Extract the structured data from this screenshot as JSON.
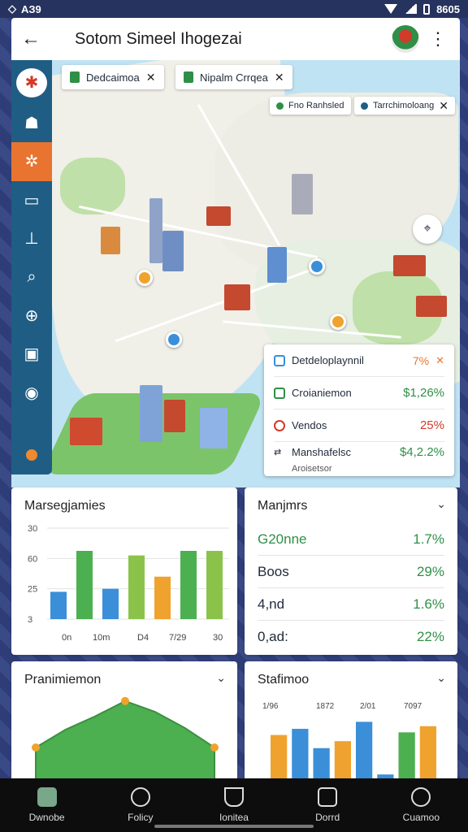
{
  "status_bar": {
    "time": "AЗ9",
    "right_text": "8605"
  },
  "app_bar": {
    "title": "Sotom Simeel Ihogezai"
  },
  "chips": [
    {
      "label": "Dedcaimoa"
    },
    {
      "label": "Nipalm Crrqea"
    },
    {
      "label": "Fno Ranhsled"
    },
    {
      "label": "Tarrchimoloang"
    }
  ],
  "legend": {
    "title": "Detdeloplaynnil",
    "title_value": "7%",
    "rows": [
      {
        "label": "Croianiemon",
        "value": "$1,26%",
        "color": "#2f8f47"
      },
      {
        "label": "Vendos",
        "value": "25%",
        "color": "#d23a2a"
      },
      {
        "label": "Manshafelsc",
        "sublabel": "Aroisetsor",
        "value": "$4,2.2%",
        "color": "#2f8f47"
      }
    ]
  },
  "cards": {
    "bar_chart": {
      "title": "Marsegjamies",
      "y_ticks": [
        "30",
        "60",
        "25",
        "3"
      ],
      "x_ticks": [
        "0n",
        "10m",
        "D4",
        "7/29",
        "30"
      ]
    },
    "stats": {
      "title": "Manjmrs",
      "rows": [
        {
          "label": "G20nne",
          "value": "1.7%"
        },
        {
          "label": "Boos",
          "value": "29%"
        },
        {
          "label": "4,nd",
          "value": "1.6%"
        },
        {
          "label": "0,ad:",
          "value": "22%"
        }
      ]
    },
    "area_chart": {
      "title": "Pranimiemon"
    },
    "bar_chart2": {
      "title": "Stafimoo",
      "x_ticks": [
        "1/96",
        "1872",
        "2/01",
        "7097"
      ]
    }
  },
  "colors": {
    "green": "#4caf50",
    "light_green": "#8bc34a",
    "blue": "#3a8fd8",
    "orange": "#f0a22e"
  },
  "chart_data": [
    {
      "type": "bar",
      "title": "Marsegjamies",
      "categories": [
        "0n",
        "10m",
        "D4",
        "7/29",
        "30"
      ],
      "ylim": [
        0,
        60
      ],
      "series": [
        {
          "values": [
            18,
            45,
            20,
            42,
            28,
            45,
            45
          ]
        }
      ]
    },
    {
      "type": "area",
      "title": "Pranimiemon",
      "values": [
        40,
        60,
        75,
        92,
        80,
        62,
        40
      ]
    },
    {
      "type": "bar",
      "title": "Stafimoo",
      "categories": [
        "1/96",
        "1872",
        "2/01",
        "7097"
      ],
      "series": [
        {
          "values": [
            55,
            62,
            40,
            48,
            70,
            10,
            58,
            65
          ]
        }
      ]
    }
  ],
  "nav": [
    {
      "label": "Dwnobe"
    },
    {
      "label": "Folicy"
    },
    {
      "label": "Ionitea"
    },
    {
      "label": "Dorrd"
    },
    {
      "label": "Cuamoo"
    }
  ]
}
